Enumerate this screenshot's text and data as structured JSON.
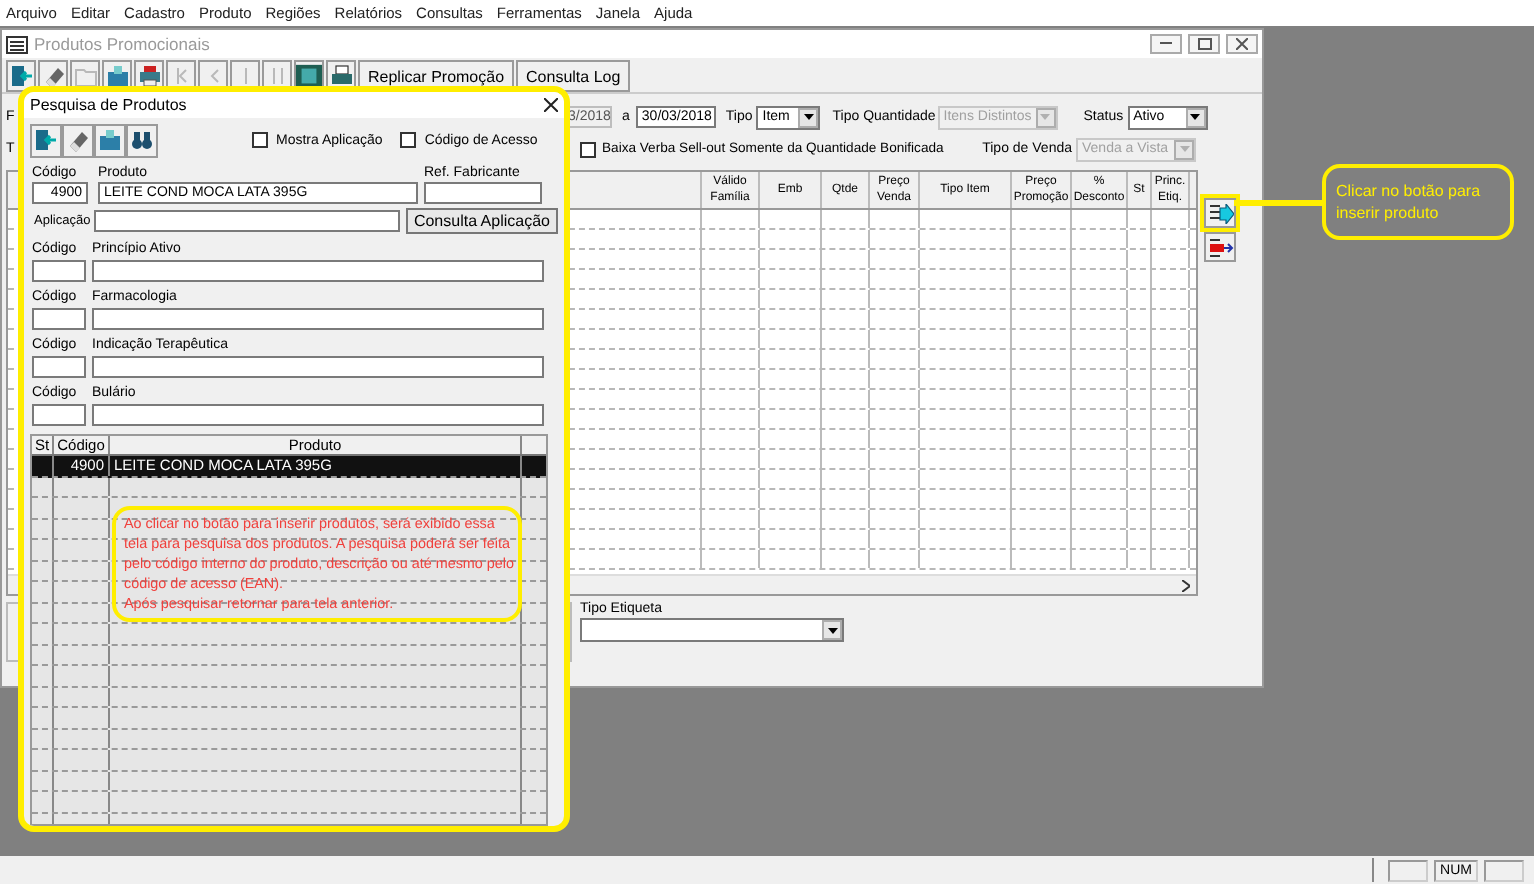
{
  "menu": [
    "Arquivo",
    "Editar",
    "Cadastro",
    "Produto",
    "Regiões",
    "Relatórios",
    "Consultas",
    "Ferramentas",
    "Janela",
    "Ajuda"
  ],
  "main_window": {
    "title": "Produtos Promocionais",
    "toolbar": [
      {
        "kind": "icon",
        "disabled": false
      },
      {
        "kind": "icon",
        "disabled": false
      },
      {
        "kind": "icon",
        "disabled": true
      },
      {
        "kind": "icon",
        "disabled": false
      },
      {
        "kind": "icon",
        "disabled": false
      },
      {
        "kind": "icon",
        "disabled": true
      },
      {
        "kind": "icon",
        "disabled": true
      },
      {
        "kind": "icon",
        "disabled": true
      },
      {
        "kind": "icon",
        "disabled": true
      },
      {
        "kind": "icon",
        "disabled": false
      },
      {
        "kind": "icon",
        "disabled": false
      },
      {
        "kind": "text",
        "label": "Replicar Promoção",
        "disabled": false
      },
      {
        "kind": "text",
        "label": "Consulta Log",
        "disabled": false
      }
    ],
    "edge_labels": [
      "F",
      "T"
    ],
    "date_from": {
      "value": "3/2018",
      "disabled": true
    },
    "to_label": "a",
    "date_to": {
      "value": "30/03/2018",
      "disabled": false
    },
    "tipo": {
      "label": "Tipo",
      "value": "Item",
      "disabled": false
    },
    "tipo_quantidade": {
      "label": "Tipo Quantidade",
      "value": "Itens Distintos",
      "disabled": true
    },
    "status": {
      "label": "Status",
      "value": "Ativo",
      "disabled": false
    },
    "baixa_verba": {
      "label": "Baixa Verba Sell-out Somente da Quantidade Bonificada",
      "checked": false
    },
    "tipo_venda": {
      "label": "Tipo de Venda",
      "value": "Venda a Vista",
      "disabled": true
    },
    "grid_columns": [
      "Válido Família",
      "Emb",
      "Qtde",
      "Preço Venda",
      "Tipo Item",
      "Preço Promoção",
      "% Desconto",
      "St",
      "Princ. Etiq."
    ],
    "tipo_etiqueta": {
      "label": "Tipo Etiqueta"
    }
  },
  "dialog": {
    "title": "Pesquisa de Produtos",
    "checkboxes": [
      {
        "label": "Mostra Aplicação",
        "checked": false
      },
      {
        "label": "Código de Acesso",
        "checked": false
      }
    ],
    "codigo_label": "Código",
    "codigo": "4900",
    "produto_label": "Produto",
    "produto": "LEITE COND MOCA LATA 395G",
    "ref_label": "Ref. Fabricante",
    "aplicacao_label": "Aplicação",
    "consulta_button": "Consulta Aplicação",
    "lookups": [
      {
        "code_label": "Código",
        "name_label": "Princípio Ativo"
      },
      {
        "code_label": "Código",
        "name_label": "Farmacologia"
      },
      {
        "code_label": "Código",
        "name_label": "Indicação Terapêutica"
      },
      {
        "code_label": "Código",
        "name_label": "Bulário"
      }
    ],
    "results": {
      "columns": [
        "St",
        "Código",
        "Produto"
      ],
      "rows": [
        {
          "codigo": "4900",
          "produto": "LEITE COND MOCA LATA 395G",
          "selected": true
        }
      ]
    }
  },
  "note": {
    "lines": [
      "Ao clicar no botão para inserir produtos, será exibido essa tela para pesquisa dos produtos. A pesquisa poderá ser feita pelo código interno do produto, descrição ou até mesmo pelo código de acesso (EAN).",
      "Após pesquisar retornar para tela anterior."
    ]
  },
  "callout": {
    "text": "Clicar no botão para inserir produto"
  },
  "status_bar": {
    "panels": [
      "NUM"
    ]
  }
}
